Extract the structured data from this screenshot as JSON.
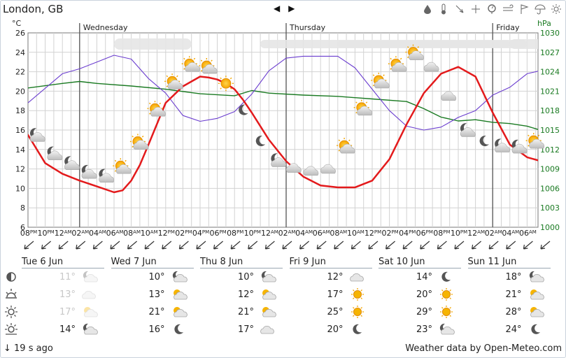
{
  "location": "London, GB",
  "nav": {
    "prev": "◀",
    "next": "▶"
  },
  "toolbar": [
    "rain-icon",
    "thermometer-icon",
    "wind-direction-icon",
    "crosshair-icon",
    "pressure-icon",
    "wind-icon",
    "flag-icon",
    "umbrella-icon",
    "sun-icon"
  ],
  "chart": {
    "left_unit": "°C",
    "right_unit": "hPa",
    "y_ticks": [
      "26",
      "24",
      "22",
      "20",
      "18",
      "16",
      "14",
      "12",
      "10",
      "8",
      "6"
    ],
    "p_ticks": [
      "1030",
      "1027",
      "1024",
      "1021",
      "1018",
      "1015",
      "1012",
      "1009",
      "1006",
      "1003",
      "1000"
    ],
    "day_labels": [
      "Wednesday",
      "Thursday",
      "Friday"
    ],
    "hour_labels": [
      {
        "h": "08",
        "ap": "PM"
      },
      {
        "h": "10",
        "ap": "PM"
      },
      {
        "h": "12",
        "ap": "AM"
      },
      {
        "h": "02",
        "ap": "AM"
      },
      {
        "h": "04",
        "ap": "AM"
      },
      {
        "h": "06",
        "ap": "AM"
      },
      {
        "h": "08",
        "ap": "AM"
      },
      {
        "h": "10",
        "ap": "AM"
      },
      {
        "h": "12",
        "ap": "PM"
      },
      {
        "h": "02",
        "ap": "PM"
      },
      {
        "h": "04",
        "ap": "PM"
      },
      {
        "h": "06",
        "ap": "PM"
      },
      {
        "h": "08",
        "ap": "PM"
      },
      {
        "h": "10",
        "ap": "PM"
      },
      {
        "h": "12",
        "ap": "AM"
      },
      {
        "h": "02",
        "ap": "AM"
      },
      {
        "h": "04",
        "ap": "AM"
      },
      {
        "h": "06",
        "ap": "AM"
      },
      {
        "h": "08",
        "ap": "AM"
      },
      {
        "h": "10",
        "ap": "AM"
      },
      {
        "h": "12",
        "ap": "PM"
      },
      {
        "h": "02",
        "ap": "PM"
      },
      {
        "h": "04",
        "ap": "PM"
      },
      {
        "h": "06",
        "ap": "PM"
      },
      {
        "h": "08",
        "ap": "PM"
      },
      {
        "h": "10",
        "ap": "PM"
      },
      {
        "h": "12",
        "ap": "AM"
      },
      {
        "h": "02",
        "ap": "AM"
      },
      {
        "h": "04",
        "ap": "AM"
      },
      {
        "h": "06",
        "ap": "AM"
      }
    ]
  },
  "chart_data": {
    "type": "line",
    "x_unit": "hours from Tue 6 Jun 6 PM",
    "series": [
      {
        "name": "temperature",
        "color": "#e31a1c",
        "unit": "°C",
        "x": [
          0,
          2,
          4,
          6,
          8,
          10,
          11,
          12,
          13,
          14,
          16,
          18,
          20,
          21,
          22,
          23,
          24,
          25,
          26,
          28,
          30,
          32,
          34,
          36,
          38,
          40,
          42,
          44,
          46,
          48,
          50,
          52,
          54,
          56,
          58,
          60
        ],
        "y": [
          15.5,
          12.6,
          11.5,
          10.8,
          10.2,
          9.6,
          9.8,
          10.8,
          12.4,
          14.5,
          18.8,
          20.5,
          21.5,
          21.4,
          21.2,
          20.8,
          20.2,
          19.1,
          17.8,
          15,
          12.8,
          11.2,
          10.3,
          10.1,
          10.1,
          10.8,
          13,
          16.6,
          19.8,
          21.8,
          22.5,
          21.5,
          17.8,
          14.5,
          13.2,
          12.7
        ]
      },
      {
        "name": "humidity",
        "color": "#6a3ccf",
        "x": [
          0,
          4,
          6,
          8,
          10,
          12,
          14,
          16,
          18,
          20,
          22,
          24,
          26,
          28,
          30,
          32,
          34,
          36,
          38,
          40,
          42,
          44,
          46,
          48,
          50,
          52,
          54,
          56,
          58,
          60
        ],
        "y": [
          18.8,
          21.8,
          22.3,
          23.0,
          23.7,
          23.3,
          21.3,
          19.8,
          17.5,
          16.9,
          17.2,
          17.9,
          19.7,
          22.1,
          23.4,
          23.6,
          23.6,
          23.6,
          22.4,
          20.2,
          18.0,
          16.4,
          16.0,
          16.3,
          17.3,
          18.0,
          19.6,
          20.4,
          21.8,
          22.2
        ]
      },
      {
        "name": "pressure",
        "color": "#1a7a22",
        "unit": "hPa",
        "x": [
          0,
          4,
          6,
          8,
          12,
          16,
          20,
          24,
          26,
          28,
          32,
          36,
          40,
          44,
          46,
          48,
          50,
          52,
          54,
          56,
          58,
          60
        ],
        "y": [
          1021.5,
          1022.2,
          1022.5,
          1022.2,
          1021.8,
          1021.3,
          1020.6,
          1020.3,
          1021.1,
          1020.7,
          1020.4,
          1020.2,
          1019.8,
          1019.4,
          1018.3,
          1017.0,
          1016.4,
          1016.6,
          1016.2,
          1016.0,
          1015.6,
          1014.8
        ]
      }
    ],
    "ylim": [
      6,
      26
    ],
    "y2lim": [
      1000,
      1030
    ]
  },
  "wind_arrows_count": 31,
  "days": [
    {
      "name": "Tue 6 Jun",
      "rows": [
        {
          "t": "11°",
          "icon": "night-partly-cloudy",
          "dim": true
        },
        {
          "t": "13°",
          "icon": "cloudy",
          "dim": true
        },
        {
          "t": "17°",
          "icon": "partly-cloudy",
          "dim": true
        },
        {
          "t": "14°",
          "icon": "night-partly-cloudy",
          "dim": false
        }
      ]
    },
    {
      "name": "Wed 7 Jun",
      "rows": [
        {
          "t": "10°",
          "icon": "night-partly-cloudy",
          "dim": false
        },
        {
          "t": "13°",
          "icon": "partly-cloudy",
          "dim": false
        },
        {
          "t": "21°",
          "icon": "partly-cloudy",
          "dim": false
        },
        {
          "t": "16°",
          "icon": "moon",
          "dim": false
        }
      ]
    },
    {
      "name": "Thu 8 Jun",
      "rows": [
        {
          "t": "10°",
          "icon": "night-partly-cloudy",
          "dim": false
        },
        {
          "t": "12°",
          "icon": "partly-cloudy",
          "dim": false
        },
        {
          "t": "21°",
          "icon": "partly-cloudy",
          "dim": false
        },
        {
          "t": "17°",
          "icon": "cloudy",
          "dim": false
        }
      ]
    },
    {
      "name": "Fri 9 Jun",
      "rows": [
        {
          "t": "12°",
          "icon": "cloudy",
          "dim": false
        },
        {
          "t": "17°",
          "icon": "sun",
          "dim": false
        },
        {
          "t": "25°",
          "icon": "sun",
          "dim": false
        },
        {
          "t": "20°",
          "icon": "moon",
          "dim": false
        }
      ]
    },
    {
      "name": "Sat 10 Jun",
      "rows": [
        {
          "t": "14°",
          "icon": "moon",
          "dim": false
        },
        {
          "t": "20°",
          "icon": "sun",
          "dim": false
        },
        {
          "t": "29°",
          "icon": "sun",
          "dim": false
        },
        {
          "t": "23°",
          "icon": "night-partly-cloudy",
          "dim": false
        }
      ]
    },
    {
      "name": "Sun 11 Jun",
      "rows": [
        {
          "t": "18°",
          "icon": "night-partly-cloudy",
          "dim": false
        },
        {
          "t": "21°",
          "icon": "partly-cloudy",
          "dim": false
        },
        {
          "t": "28°",
          "icon": "partly-cloudy",
          "dim": false
        },
        {
          "t": "24°",
          "icon": "moon",
          "dim": false
        }
      ]
    }
  ],
  "row_icons": [
    "moon-phase-icon",
    "sunrise-icon",
    "sun-noon-icon",
    "sunset-icon"
  ],
  "footer": {
    "updated": "↓ 19 s ago",
    "credit": "Weather data by Open-Meteo.com"
  }
}
